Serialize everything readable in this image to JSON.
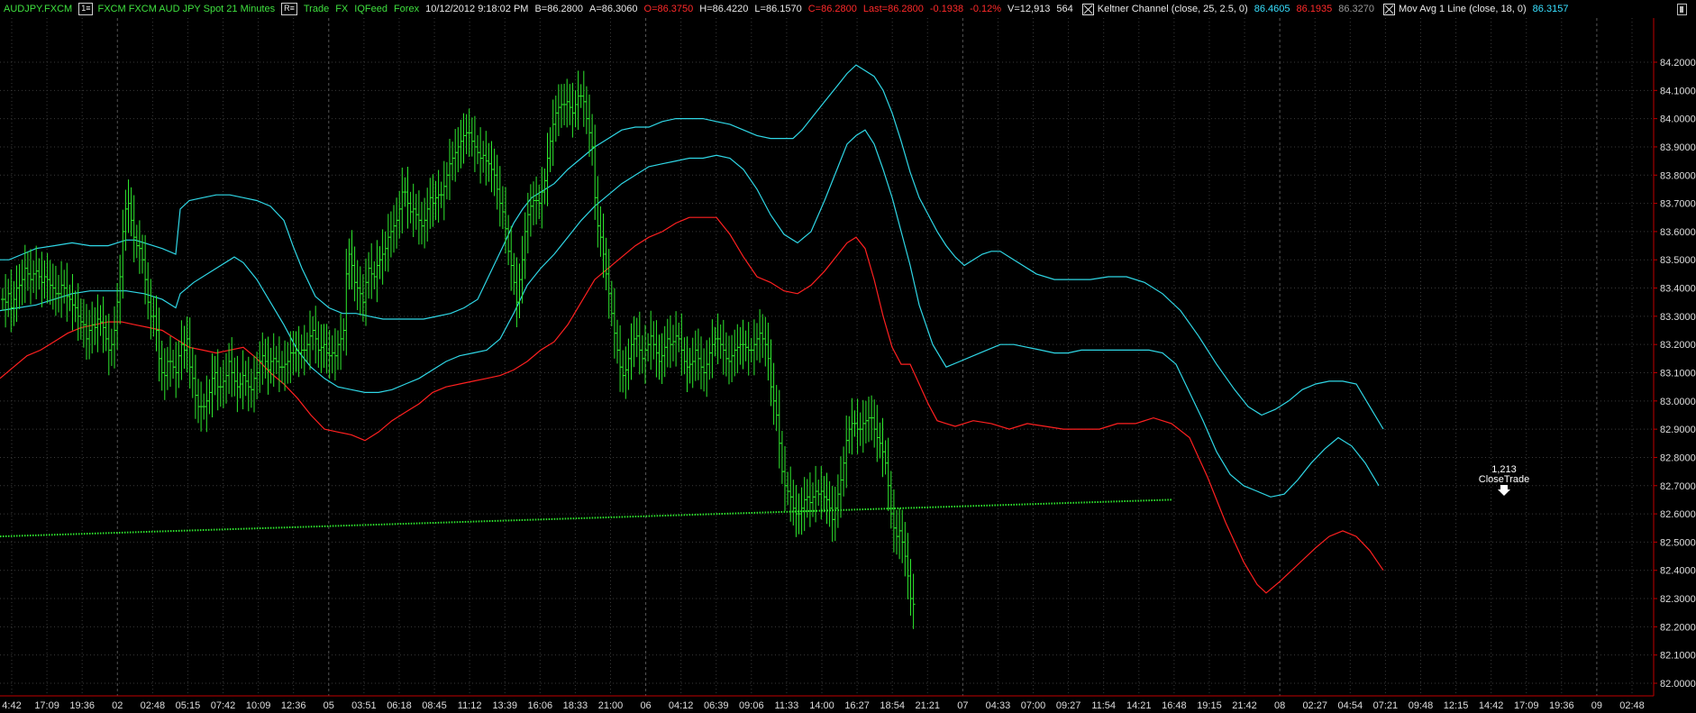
{
  "toolbar": {
    "symbol": "AUDJPY.FXCM",
    "interval_button": "1≡",
    "description": "FXCM FXCM AUD JPY Spot  21 Minutes",
    "replay_button": "R≡",
    "trade_label": "Trade",
    "fx_label": "FX",
    "feed_label": "IQFeed",
    "forex_label": "Forex",
    "datetime": "10/12/2012  9:18:02 PM",
    "bid": "B=86.2800",
    "ask": "A=86.3060",
    "open": "O=86.3750",
    "high": "H=86.4220",
    "low": "L=86.1570",
    "close": "C=86.2800",
    "last": "Last=86.2800",
    "change": "-0.1938",
    "change_pct": "-0.12%",
    "volume": "V=12,913",
    "ticks": "564",
    "keltner_label": "Keltner Channel  (close,  25,  2.5,  0)",
    "keltner_upper": "86.4605",
    "keltner_lower": "86.1935",
    "keltner_mid": "86.3270",
    "mavg_label": "Mov Avg 1 Line  (close,  18,  0)",
    "mavg_value": "86.3157"
  },
  "colors": {
    "background": "#000000",
    "bars": "#2ee82e",
    "channel": "#2fd7e6",
    "mavg": "#ff2020",
    "grid": "#3a3a3a",
    "axis": "#c00000",
    "trend": "#2ee82e"
  },
  "price_axis": {
    "labels": [
      "84.2000",
      "84.1000",
      "84.0000",
      "83.9000",
      "83.8000",
      "83.7000",
      "83.6000",
      "83.5000",
      "83.4000",
      "83.3000",
      "83.2000",
      "83.1000",
      "83.0000",
      "82.9000",
      "82.8000",
      "82.7000",
      "82.6000",
      "82.5000",
      "82.4000",
      "82.3000",
      "82.2000",
      "82.1000",
      "82.0000"
    ],
    "max": 84.2,
    "min": 82.0
  },
  "time_axis": {
    "labels": [
      "4:42",
      "17:09",
      "19:36",
      "02",
      "02:48",
      "05:15",
      "07:42",
      "10:09",
      "12:36",
      "05",
      "03:51",
      "06:18",
      "08:45",
      "11:12",
      "13:39",
      "16:06",
      "18:33",
      "21:00",
      "06",
      "04:12",
      "06:39",
      "09:06",
      "11:33",
      "14:00",
      "16:27",
      "18:54",
      "21:21",
      "07",
      "04:33",
      "07:00",
      "09:27",
      "11:54",
      "14:21",
      "16:48",
      "19:15",
      "21:42",
      "08",
      "02:27",
      "04:54",
      "07:21",
      "09:48",
      "12:15",
      "14:42",
      "17:09",
      "19:36",
      "09",
      "02:48"
    ]
  },
  "annotation": {
    "qty": "1,213",
    "label": "CloseTrade",
    "icon": "down-arrow-icon"
  },
  "chart_data": {
    "type": "line",
    "symbol": "AUDJPY.FXCM",
    "ylim": [
      82.0,
      84.2
    ],
    "series": [
      {
        "name": "Keltner Channel upper",
        "x": [
          0,
          10,
          25,
          40,
          60,
          80,
          100,
          120,
          140,
          150,
          160,
          170,
          180,
          195,
          200,
          210,
          225,
          240,
          255,
          270,
          285,
          300,
          315,
          325,
          335,
          350,
          365,
          380,
          395,
          410,
          425,
          440,
          455,
          470,
          485,
          500,
          515,
          530,
          545,
          560,
          570,
          580,
          590,
          600,
          615,
          630,
          645,
          660,
          675,
          690,
          705,
          720,
          735,
          750,
          765,
          780,
          795,
          810,
          825,
          840,
          855,
          870,
          880,
          890,
          900,
          915,
          930,
          940,
          950,
          960,
          970,
          980,
          990,
          1000,
          1010,
          1020,
          1030,
          1040,
          1050,
          1060,
          1070,
          1080,
          1090,
          1100,
          1110,
          1120,
          1135,
          1150,
          1170,
          1190,
          1210,
          1230,
          1250,
          1270,
          1290,
          1310,
          1330,
          1350,
          1370,
          1385,
          1400,
          1415,
          1430,
          1445,
          1460,
          1475,
          1490,
          1505,
          1520,
          1535
        ],
        "y": [
          83.5,
          83.5,
          83.52,
          83.54,
          83.55,
          83.56,
          83.55,
          83.55,
          83.57,
          83.57,
          83.56,
          83.55,
          83.54,
          83.52,
          83.68,
          83.71,
          83.72,
          83.73,
          83.73,
          83.72,
          83.71,
          83.69,
          83.64,
          83.55,
          83.47,
          83.37,
          83.33,
          83.31,
          83.31,
          83.3,
          83.29,
          83.29,
          83.29,
          83.29,
          83.3,
          83.31,
          83.33,
          83.36,
          83.46,
          83.56,
          83.63,
          83.68,
          83.72,
          83.74,
          83.77,
          83.82,
          83.86,
          83.9,
          83.93,
          83.96,
          83.97,
          83.97,
          83.99,
          84.0,
          84.0,
          84.0,
          83.99,
          83.98,
          83.96,
          83.94,
          83.93,
          83.93,
          83.93,
          83.96,
          84.0,
          84.06,
          84.12,
          84.16,
          84.19,
          84.17,
          84.15,
          84.1,
          84.02,
          83.92,
          83.81,
          83.72,
          83.66,
          83.6,
          83.55,
          83.51,
          83.48,
          83.5,
          83.52,
          83.53,
          83.53,
          83.51,
          83.48,
          83.45,
          83.43,
          83.43,
          83.43,
          83.44,
          83.44,
          83.42,
          83.38,
          83.32,
          83.23,
          83.13,
          83.04,
          82.98,
          82.95,
          82.97,
          83.0,
          83.04,
          83.06,
          83.07,
          83.07,
          83.06,
          82.98,
          82.9
        ]
      },
      {
        "name": "Keltner Channel middle",
        "x": [
          0,
          20,
          40,
          60,
          80,
          100,
          120,
          140,
          160,
          180,
          195,
          200,
          215,
          230,
          245,
          260,
          270,
          285,
          300,
          315,
          330,
          345,
          360,
          375,
          390,
          405,
          420,
          435,
          450,
          465,
          480,
          495,
          510,
          525,
          540,
          555,
          570,
          585,
          600,
          615,
          630,
          645,
          660,
          675,
          690,
          705,
          720,
          735,
          750,
          765,
          780,
          795,
          810,
          825,
          840,
          855,
          870,
          885,
          900,
          915,
          930,
          940,
          950,
          960,
          970,
          980,
          990,
          1000,
          1010,
          1020,
          1035,
          1050,
          1065,
          1080,
          1095,
          1110,
          1125,
          1140,
          1155,
          1170,
          1185,
          1200,
          1215,
          1230,
          1245,
          1260,
          1275,
          1290,
          1305,
          1320,
          1335,
          1350,
          1365,
          1380,
          1395,
          1410,
          1425,
          1440,
          1455,
          1470,
          1485,
          1500,
          1515,
          1530
        ],
        "y": [
          83.32,
          83.33,
          83.34,
          83.36,
          83.38,
          83.39,
          83.39,
          83.39,
          83.38,
          83.36,
          83.33,
          83.38,
          83.42,
          83.45,
          83.48,
          83.51,
          83.49,
          83.43,
          83.35,
          83.27,
          83.18,
          83.12,
          83.08,
          83.05,
          83.04,
          83.03,
          83.03,
          83.04,
          83.06,
          83.08,
          83.11,
          83.14,
          83.16,
          83.17,
          83.18,
          83.22,
          83.31,
          83.41,
          83.47,
          83.52,
          83.58,
          83.64,
          83.69,
          83.73,
          83.77,
          83.8,
          83.83,
          83.84,
          83.85,
          83.86,
          83.86,
          83.87,
          83.86,
          83.82,
          83.75,
          83.66,
          83.59,
          83.56,
          83.6,
          83.71,
          83.83,
          83.91,
          83.94,
          83.96,
          83.91,
          83.82,
          83.72,
          83.6,
          83.48,
          83.34,
          83.2,
          83.12,
          83.14,
          83.16,
          83.18,
          83.2,
          83.2,
          83.19,
          83.18,
          83.17,
          83.17,
          83.18,
          83.18,
          83.18,
          83.18,
          83.18,
          83.18,
          83.17,
          83.13,
          83.03,
          82.93,
          82.82,
          82.74,
          82.7,
          82.68,
          82.66,
          82.67,
          82.72,
          82.78,
          82.83,
          82.87,
          82.84,
          82.78,
          82.7
        ]
      },
      {
        "name": "Mov Avg 1 Line",
        "x": [
          0,
          15,
          30,
          45,
          60,
          75,
          90,
          105,
          120,
          135,
          150,
          165,
          180,
          195,
          210,
          225,
          240,
          255,
          270,
          285,
          300,
          315,
          330,
          345,
          360,
          375,
          390,
          405,
          420,
          435,
          450,
          465,
          480,
          495,
          510,
          525,
          540,
          555,
          570,
          585,
          600,
          615,
          630,
          645,
          660,
          675,
          690,
          705,
          720,
          735,
          750,
          765,
          780,
          795,
          810,
          825,
          840,
          855,
          870,
          885,
          900,
          915,
          930,
          940,
          950,
          960,
          970,
          980,
          990,
          1000,
          1010,
          1020,
          1030,
          1040,
          1050,
          1060,
          1080,
          1100,
          1120,
          1140,
          1160,
          1180,
          1200,
          1220,
          1240,
          1260,
          1280,
          1300,
          1320,
          1340,
          1360,
          1380,
          1395,
          1405,
          1420,
          1440,
          1460,
          1475,
          1490,
          1505,
          1520,
          1535
        ],
        "y": [
          83.08,
          83.12,
          83.16,
          83.18,
          83.21,
          83.24,
          83.26,
          83.27,
          83.28,
          83.28,
          83.27,
          83.26,
          83.25,
          83.22,
          83.19,
          83.18,
          83.17,
          83.18,
          83.19,
          83.15,
          83.1,
          83.06,
          83.01,
          82.95,
          82.9,
          82.89,
          82.88,
          82.86,
          82.89,
          82.93,
          82.96,
          82.99,
          83.03,
          83.05,
          83.06,
          83.07,
          83.08,
          83.09,
          83.11,
          83.14,
          83.18,
          83.21,
          83.27,
          83.35,
          83.43,
          83.47,
          83.51,
          83.55,
          83.58,
          83.6,
          83.63,
          83.65,
          83.65,
          83.65,
          83.59,
          83.51,
          83.44,
          83.42,
          83.39,
          83.38,
          83.41,
          83.46,
          83.52,
          83.56,
          83.58,
          83.54,
          83.43,
          83.3,
          83.19,
          83.13,
          83.13,
          83.06,
          82.99,
          82.93,
          82.92,
          82.91,
          82.93,
          82.92,
          82.9,
          82.92,
          82.91,
          82.9,
          82.9,
          82.9,
          82.92,
          82.92,
          82.94,
          82.92,
          82.87,
          82.73,
          82.57,
          82.43,
          82.35,
          82.32,
          82.36,
          82.42,
          82.48,
          82.52,
          82.54,
          82.52,
          82.47,
          82.4
        ]
      },
      {
        "name": "Trend line",
        "x": [
          0,
          1300
        ],
        "y": [
          82.52,
          82.65
        ]
      }
    ],
    "bars": {
      "x_start": 3,
      "x_step": 3.1,
      "closes": [
        83.36,
        83.35,
        83.38,
        83.33,
        83.36,
        83.4,
        83.41,
        83.43,
        83.47,
        83.45,
        83.43,
        83.45,
        83.46,
        83.44,
        83.42,
        83.44,
        83.43,
        83.41,
        83.4,
        83.38,
        83.38,
        83.41,
        83.4,
        83.37,
        83.36,
        83.34,
        83.33,
        83.3,
        83.28,
        83.27,
        83.22,
        83.25,
        83.27,
        83.26,
        83.29,
        83.28,
        83.26,
        83.22,
        83.18,
        83.2,
        83.25,
        83.35,
        83.44,
        83.6,
        83.68,
        83.7,
        83.64,
        83.58,
        83.55,
        83.54,
        83.5,
        83.43,
        83.35,
        83.3,
        83.3,
        83.25,
        83.15,
        83.1,
        83.09,
        83.14,
        83.14,
        83.12,
        83.1,
        83.16,
        83.2,
        83.18,
        83.22,
        83.12,
        83.08,
        83.02,
        82.98,
        82.98,
        82.98,
        83.0,
        83.03,
        83.08,
        83.1,
        83.05,
        83.05,
        83.07,
        83.09,
        83.14,
        83.1,
        83.07,
        83.05,
        83.06,
        83.09,
        83.07,
        83.05,
        83.04,
        83.08,
        83.1,
        83.14,
        83.16,
        83.14,
        83.11,
        83.14,
        83.15,
        83.14,
        83.12,
        83.12,
        83.13,
        83.14,
        83.17,
        83.17,
        83.18,
        83.17,
        83.18,
        83.18,
        83.2,
        83.23,
        83.25,
        83.22,
        83.18,
        83.19,
        83.2,
        83.17,
        83.16,
        83.17,
        83.16,
        83.2,
        83.22,
        83.25,
        83.45,
        83.52,
        83.48,
        83.42,
        83.4,
        83.38,
        83.35,
        83.42,
        83.47,
        83.45,
        83.44,
        83.48,
        83.5,
        83.52,
        83.54,
        83.58,
        83.6,
        83.62,
        83.64,
        83.68,
        83.74,
        83.74,
        83.7,
        83.67,
        83.68,
        83.66,
        83.64,
        83.62,
        83.64,
        83.68,
        83.72,
        83.7,
        83.72,
        83.73,
        83.73,
        83.76,
        83.8,
        83.84,
        83.86,
        83.88,
        83.9,
        83.92,
        83.94,
        83.95,
        83.95,
        83.92,
        83.9,
        83.88,
        83.86,
        83.87,
        83.85,
        83.84,
        83.82,
        83.8,
        83.75,
        83.7,
        83.67,
        83.61,
        83.53,
        83.48,
        83.42,
        83.35,
        83.43,
        83.5,
        83.6,
        83.66,
        83.69,
        83.71,
        83.71,
        83.7,
        83.74,
        83.78,
        83.86,
        83.92,
        83.98,
        84.02,
        84.04,
        84.05,
        84.05,
        84.06,
        84.04,
        84.02,
        84.05,
        84.08,
        84.08,
        84.06,
        84.0,
        83.95,
        83.9,
        83.72,
        83.62,
        83.58,
        83.52,
        83.45,
        83.38,
        83.31,
        83.24,
        83.18,
        83.12,
        83.09,
        83.11,
        83.15,
        83.2,
        83.22,
        83.23,
        83.18,
        83.15,
        83.18,
        83.2,
        83.23,
        83.2,
        83.17,
        83.14,
        83.16,
        83.19,
        83.22,
        83.2,
        83.21,
        83.23,
        83.22,
        83.18,
        83.14,
        83.12,
        83.13,
        83.14,
        83.18,
        83.15,
        83.12,
        83.1,
        83.13,
        83.17,
        83.2,
        83.22,
        83.22,
        83.2,
        83.18,
        83.15,
        83.14,
        83.16,
        83.18,
        83.19,
        83.2,
        83.2,
        83.19,
        83.18,
        83.18,
        83.2,
        83.22,
        83.24,
        83.22,
        83.2,
        83.15,
        83.05,
        83.0,
        82.95,
        82.85,
        82.75,
        82.7,
        82.68,
        82.66,
        82.62,
        82.6,
        82.6,
        82.62,
        82.65,
        82.66,
        82.64,
        82.66,
        82.68,
        82.67,
        82.68,
        82.66,
        82.65,
        82.62,
        82.58,
        82.62,
        82.67,
        82.72,
        82.78,
        82.86,
        82.9,
        82.92,
        82.92,
        82.9,
        82.9,
        82.92,
        82.93,
        82.94,
        82.94,
        82.9,
        82.87,
        82.85,
        82.82,
        82.78,
        82.7,
        82.6,
        82.55,
        82.52,
        82.54,
        82.5,
        82.45,
        82.38,
        82.3,
        82.28
      ]
    }
  }
}
